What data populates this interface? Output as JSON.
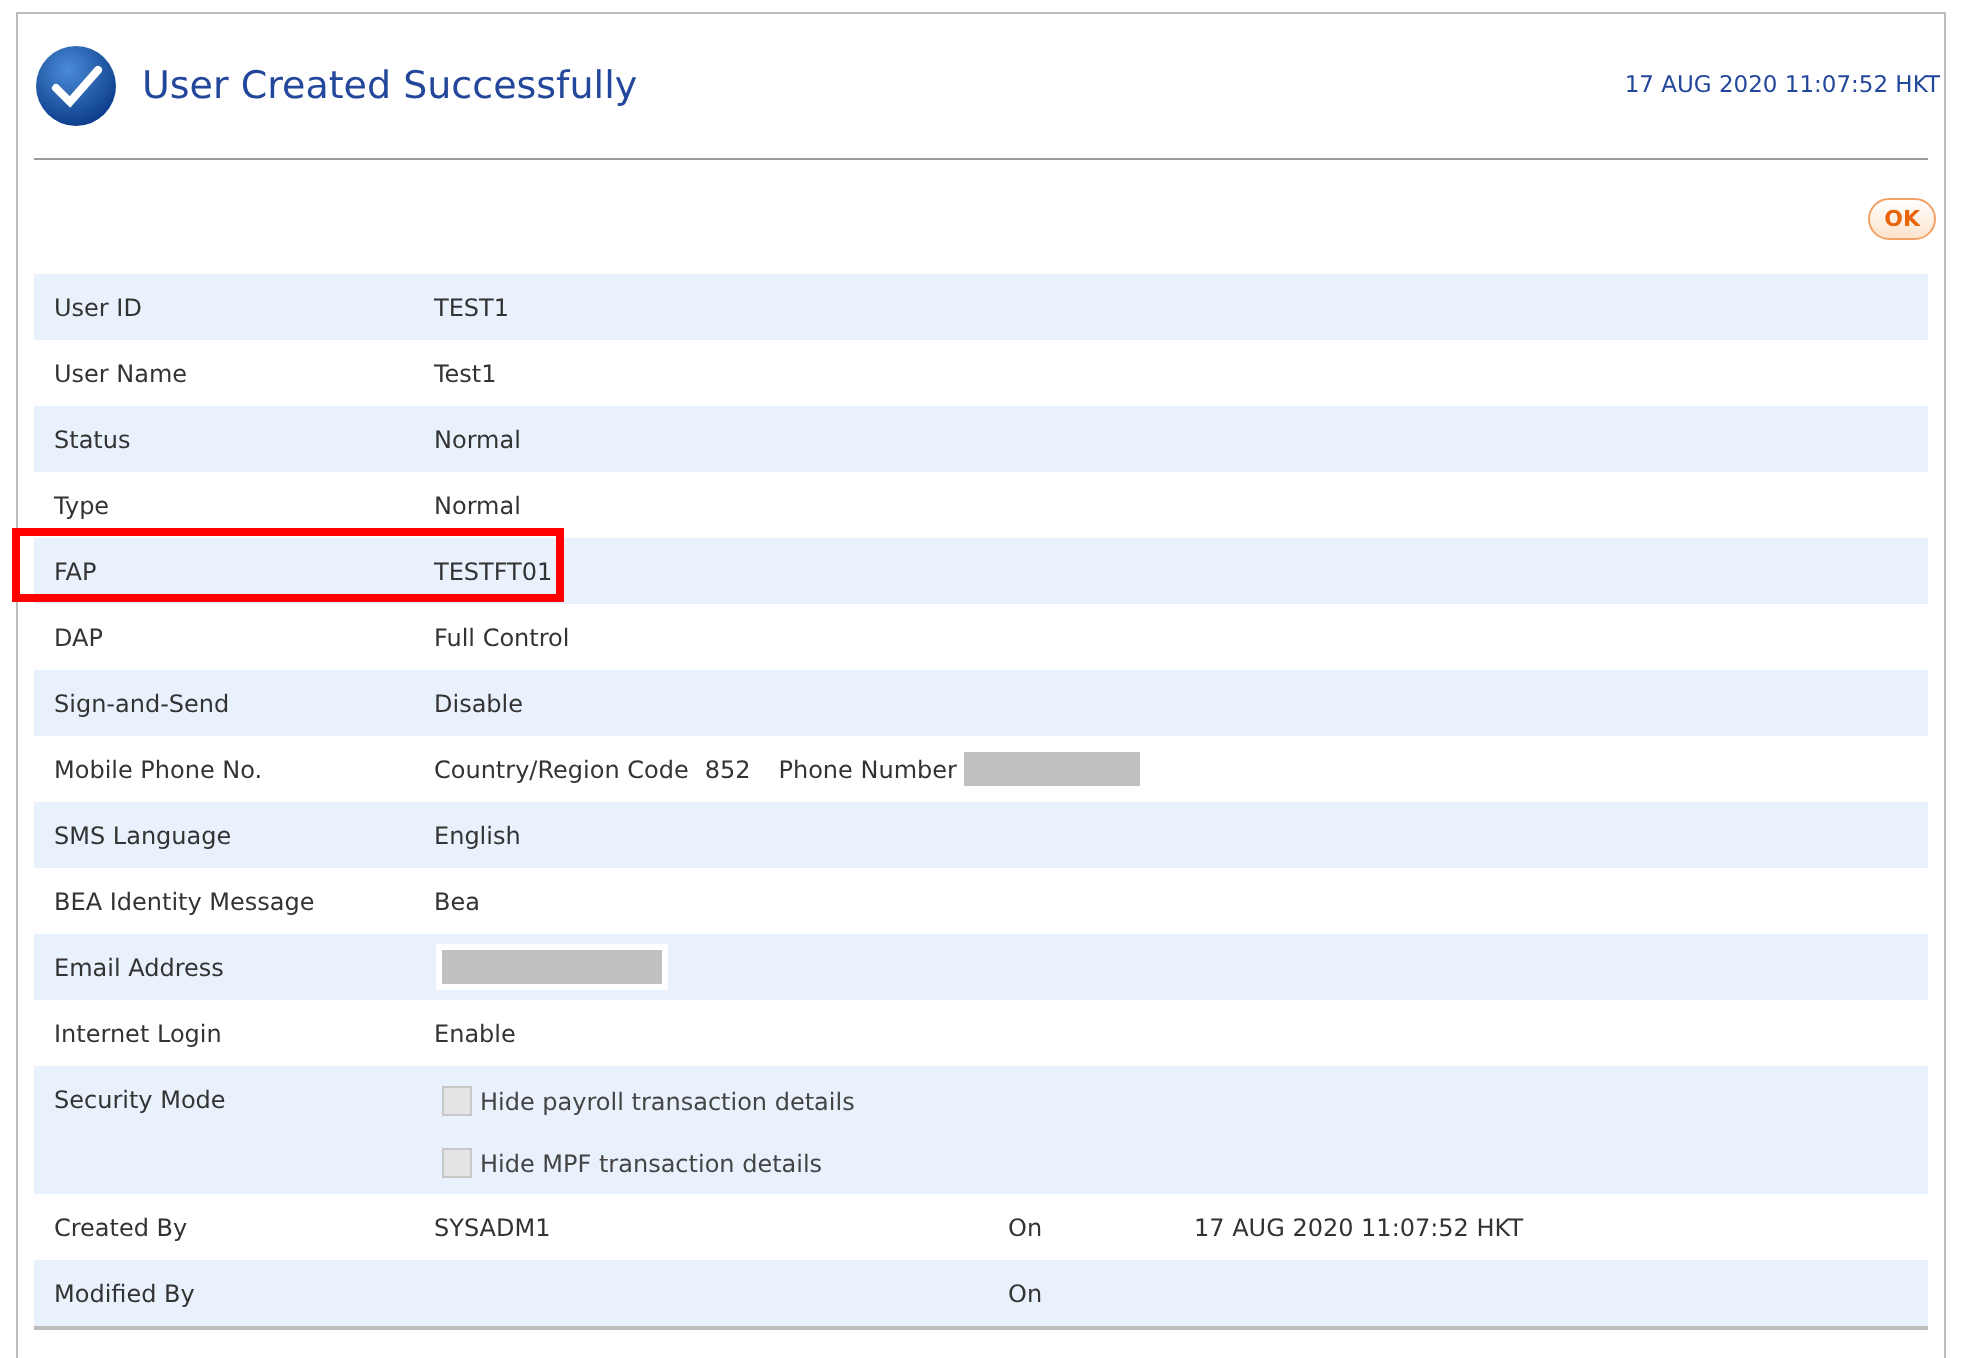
{
  "header": {
    "title": "User Created Successfully",
    "timestamp": "17 AUG 2020 11:07:52 HKT"
  },
  "ok_button": "OK",
  "rows": [
    {
      "kind": "text",
      "label": "User ID",
      "value": "TEST1",
      "highlighted": false
    },
    {
      "kind": "text",
      "label": "User Name",
      "value": "Test1",
      "highlighted": false
    },
    {
      "kind": "text",
      "label": "Status",
      "value": "Normal",
      "highlighted": false
    },
    {
      "kind": "text",
      "label": "Type",
      "value": "Normal",
      "highlighted": false
    },
    {
      "kind": "text",
      "label": "FAP",
      "value": "TESTFT01",
      "highlighted": true
    },
    {
      "kind": "text",
      "label": "DAP",
      "value": "Full Control",
      "highlighted": false
    },
    {
      "kind": "text",
      "label": "Sign-and-Send",
      "value": "Disable",
      "highlighted": false
    },
    {
      "kind": "phone",
      "label": "Mobile Phone No.",
      "code_label": "Country/Region Code",
      "code": "852",
      "number_label": "Phone Number",
      "redacted": true
    },
    {
      "kind": "text",
      "label": "SMS Language",
      "value": "English",
      "highlighted": false
    },
    {
      "kind": "text",
      "label": "BEA Identity Message",
      "value": "Bea",
      "highlighted": false
    },
    {
      "kind": "masked",
      "label": "Email Address",
      "redacted": true
    },
    {
      "kind": "text",
      "label": "Internet Login",
      "value": "Enable",
      "highlighted": false
    },
    {
      "kind": "checks",
      "label": "Security Mode",
      "options": [
        {
          "label": "Hide payroll transaction details",
          "checked": false,
          "disabled": true
        },
        {
          "label": "Hide MPF transaction details",
          "checked": false,
          "disabled": true
        }
      ]
    },
    {
      "kind": "audit",
      "label": "Created By",
      "value": "SYSADM1",
      "on_label": "On",
      "on_value": "17 AUG 2020 11:07:52 HKT"
    },
    {
      "kind": "audit",
      "label": "Modified By",
      "on_label": "On"
    }
  ]
}
